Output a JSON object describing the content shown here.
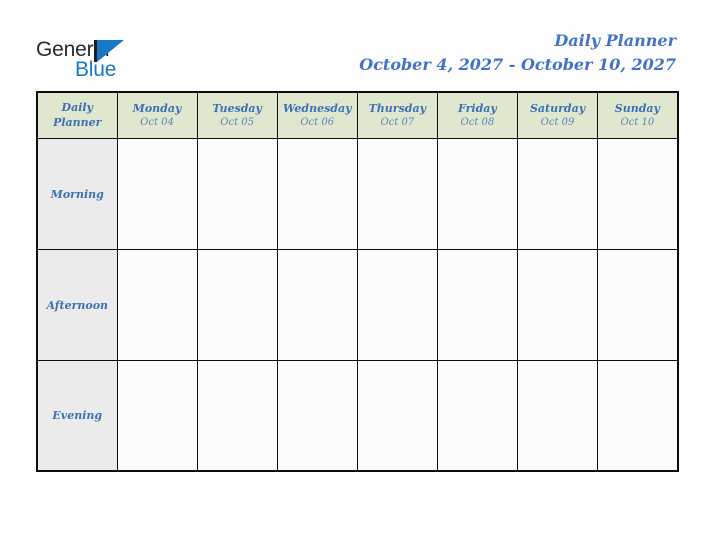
{
  "brand": {
    "name_part1": "General",
    "name_part2": "Blue",
    "logo_icon": "triangle-flag-icon",
    "accent_color": "#1878c4"
  },
  "header": {
    "title": "Daily Planner",
    "date_range": "October 4, 2027 - October 10, 2027",
    "title_color": "#4472c4"
  },
  "planner": {
    "corner_label_line1": "Daily",
    "corner_label_line2": "Planner",
    "header_background": "#dfe8ce",
    "label_background": "#ebebeb",
    "cell_background": "#fcfcfc",
    "border_color": "#0d0d0d",
    "text_color": "#3f6fb5",
    "date_text_color": "#5b84c0",
    "days": [
      {
        "name": "Monday",
        "date": "Oct 04"
      },
      {
        "name": "Tuesday",
        "date": "Oct 05"
      },
      {
        "name": "Wednesday",
        "date": "Oct 06"
      },
      {
        "name": "Thursday",
        "date": "Oct 07"
      },
      {
        "name": "Friday",
        "date": "Oct 08"
      },
      {
        "name": "Saturday",
        "date": "Oct 09"
      },
      {
        "name": "Sunday",
        "date": "Oct 10"
      }
    ],
    "time_slots": [
      {
        "label": "Morning",
        "entries": [
          "",
          "",
          "",
          "",
          "",
          "",
          ""
        ]
      },
      {
        "label": "Afternoon",
        "entries": [
          "",
          "",
          "",
          "",
          "",
          "",
          ""
        ]
      },
      {
        "label": "Evening",
        "entries": [
          "",
          "",
          "",
          "",
          "",
          "",
          ""
        ]
      }
    ]
  }
}
